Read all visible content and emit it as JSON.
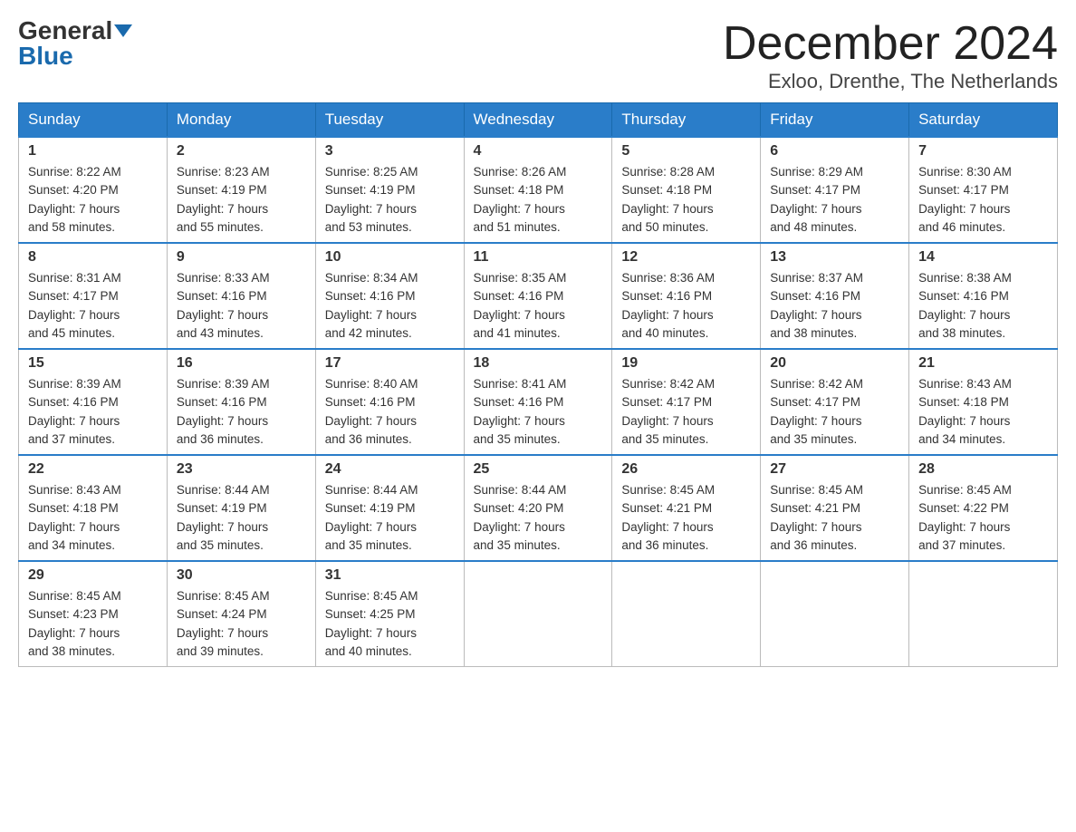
{
  "header": {
    "logo_general": "General",
    "logo_blue": "Blue",
    "title": "December 2024",
    "location": "Exloo, Drenthe, The Netherlands"
  },
  "days_of_week": [
    "Sunday",
    "Monday",
    "Tuesday",
    "Wednesday",
    "Thursday",
    "Friday",
    "Saturday"
  ],
  "weeks": [
    [
      {
        "day": "1",
        "sunrise": "8:22 AM",
        "sunset": "4:20 PM",
        "daylight": "7 hours and 58 minutes."
      },
      {
        "day": "2",
        "sunrise": "8:23 AM",
        "sunset": "4:19 PM",
        "daylight": "7 hours and 55 minutes."
      },
      {
        "day": "3",
        "sunrise": "8:25 AM",
        "sunset": "4:19 PM",
        "daylight": "7 hours and 53 minutes."
      },
      {
        "day": "4",
        "sunrise": "8:26 AM",
        "sunset": "4:18 PM",
        "daylight": "7 hours and 51 minutes."
      },
      {
        "day": "5",
        "sunrise": "8:28 AM",
        "sunset": "4:18 PM",
        "daylight": "7 hours and 50 minutes."
      },
      {
        "day": "6",
        "sunrise": "8:29 AM",
        "sunset": "4:17 PM",
        "daylight": "7 hours and 48 minutes."
      },
      {
        "day": "7",
        "sunrise": "8:30 AM",
        "sunset": "4:17 PM",
        "daylight": "7 hours and 46 minutes."
      }
    ],
    [
      {
        "day": "8",
        "sunrise": "8:31 AM",
        "sunset": "4:17 PM",
        "daylight": "7 hours and 45 minutes."
      },
      {
        "day": "9",
        "sunrise": "8:33 AM",
        "sunset": "4:16 PM",
        "daylight": "7 hours and 43 minutes."
      },
      {
        "day": "10",
        "sunrise": "8:34 AM",
        "sunset": "4:16 PM",
        "daylight": "7 hours and 42 minutes."
      },
      {
        "day": "11",
        "sunrise": "8:35 AM",
        "sunset": "4:16 PM",
        "daylight": "7 hours and 41 minutes."
      },
      {
        "day": "12",
        "sunrise": "8:36 AM",
        "sunset": "4:16 PM",
        "daylight": "7 hours and 40 minutes."
      },
      {
        "day": "13",
        "sunrise": "8:37 AM",
        "sunset": "4:16 PM",
        "daylight": "7 hours and 38 minutes."
      },
      {
        "day": "14",
        "sunrise": "8:38 AM",
        "sunset": "4:16 PM",
        "daylight": "7 hours and 38 minutes."
      }
    ],
    [
      {
        "day": "15",
        "sunrise": "8:39 AM",
        "sunset": "4:16 PM",
        "daylight": "7 hours and 37 minutes."
      },
      {
        "day": "16",
        "sunrise": "8:39 AM",
        "sunset": "4:16 PM",
        "daylight": "7 hours and 36 minutes."
      },
      {
        "day": "17",
        "sunrise": "8:40 AM",
        "sunset": "4:16 PM",
        "daylight": "7 hours and 36 minutes."
      },
      {
        "day": "18",
        "sunrise": "8:41 AM",
        "sunset": "4:16 PM",
        "daylight": "7 hours and 35 minutes."
      },
      {
        "day": "19",
        "sunrise": "8:42 AM",
        "sunset": "4:17 PM",
        "daylight": "7 hours and 35 minutes."
      },
      {
        "day": "20",
        "sunrise": "8:42 AM",
        "sunset": "4:17 PM",
        "daylight": "7 hours and 35 minutes."
      },
      {
        "day": "21",
        "sunrise": "8:43 AM",
        "sunset": "4:18 PM",
        "daylight": "7 hours and 34 minutes."
      }
    ],
    [
      {
        "day": "22",
        "sunrise": "8:43 AM",
        "sunset": "4:18 PM",
        "daylight": "7 hours and 34 minutes."
      },
      {
        "day": "23",
        "sunrise": "8:44 AM",
        "sunset": "4:19 PM",
        "daylight": "7 hours and 35 minutes."
      },
      {
        "day": "24",
        "sunrise": "8:44 AM",
        "sunset": "4:19 PM",
        "daylight": "7 hours and 35 minutes."
      },
      {
        "day": "25",
        "sunrise": "8:44 AM",
        "sunset": "4:20 PM",
        "daylight": "7 hours and 35 minutes."
      },
      {
        "day": "26",
        "sunrise": "8:45 AM",
        "sunset": "4:21 PM",
        "daylight": "7 hours and 36 minutes."
      },
      {
        "day": "27",
        "sunrise": "8:45 AM",
        "sunset": "4:21 PM",
        "daylight": "7 hours and 36 minutes."
      },
      {
        "day": "28",
        "sunrise": "8:45 AM",
        "sunset": "4:22 PM",
        "daylight": "7 hours and 37 minutes."
      }
    ],
    [
      {
        "day": "29",
        "sunrise": "8:45 AM",
        "sunset": "4:23 PM",
        "daylight": "7 hours and 38 minutes."
      },
      {
        "day": "30",
        "sunrise": "8:45 AM",
        "sunset": "4:24 PM",
        "daylight": "7 hours and 39 minutes."
      },
      {
        "day": "31",
        "sunrise": "8:45 AM",
        "sunset": "4:25 PM",
        "daylight": "7 hours and 40 minutes."
      },
      null,
      null,
      null,
      null
    ]
  ],
  "labels": {
    "sunrise": "Sunrise:",
    "sunset": "Sunset:",
    "daylight": "Daylight:"
  }
}
